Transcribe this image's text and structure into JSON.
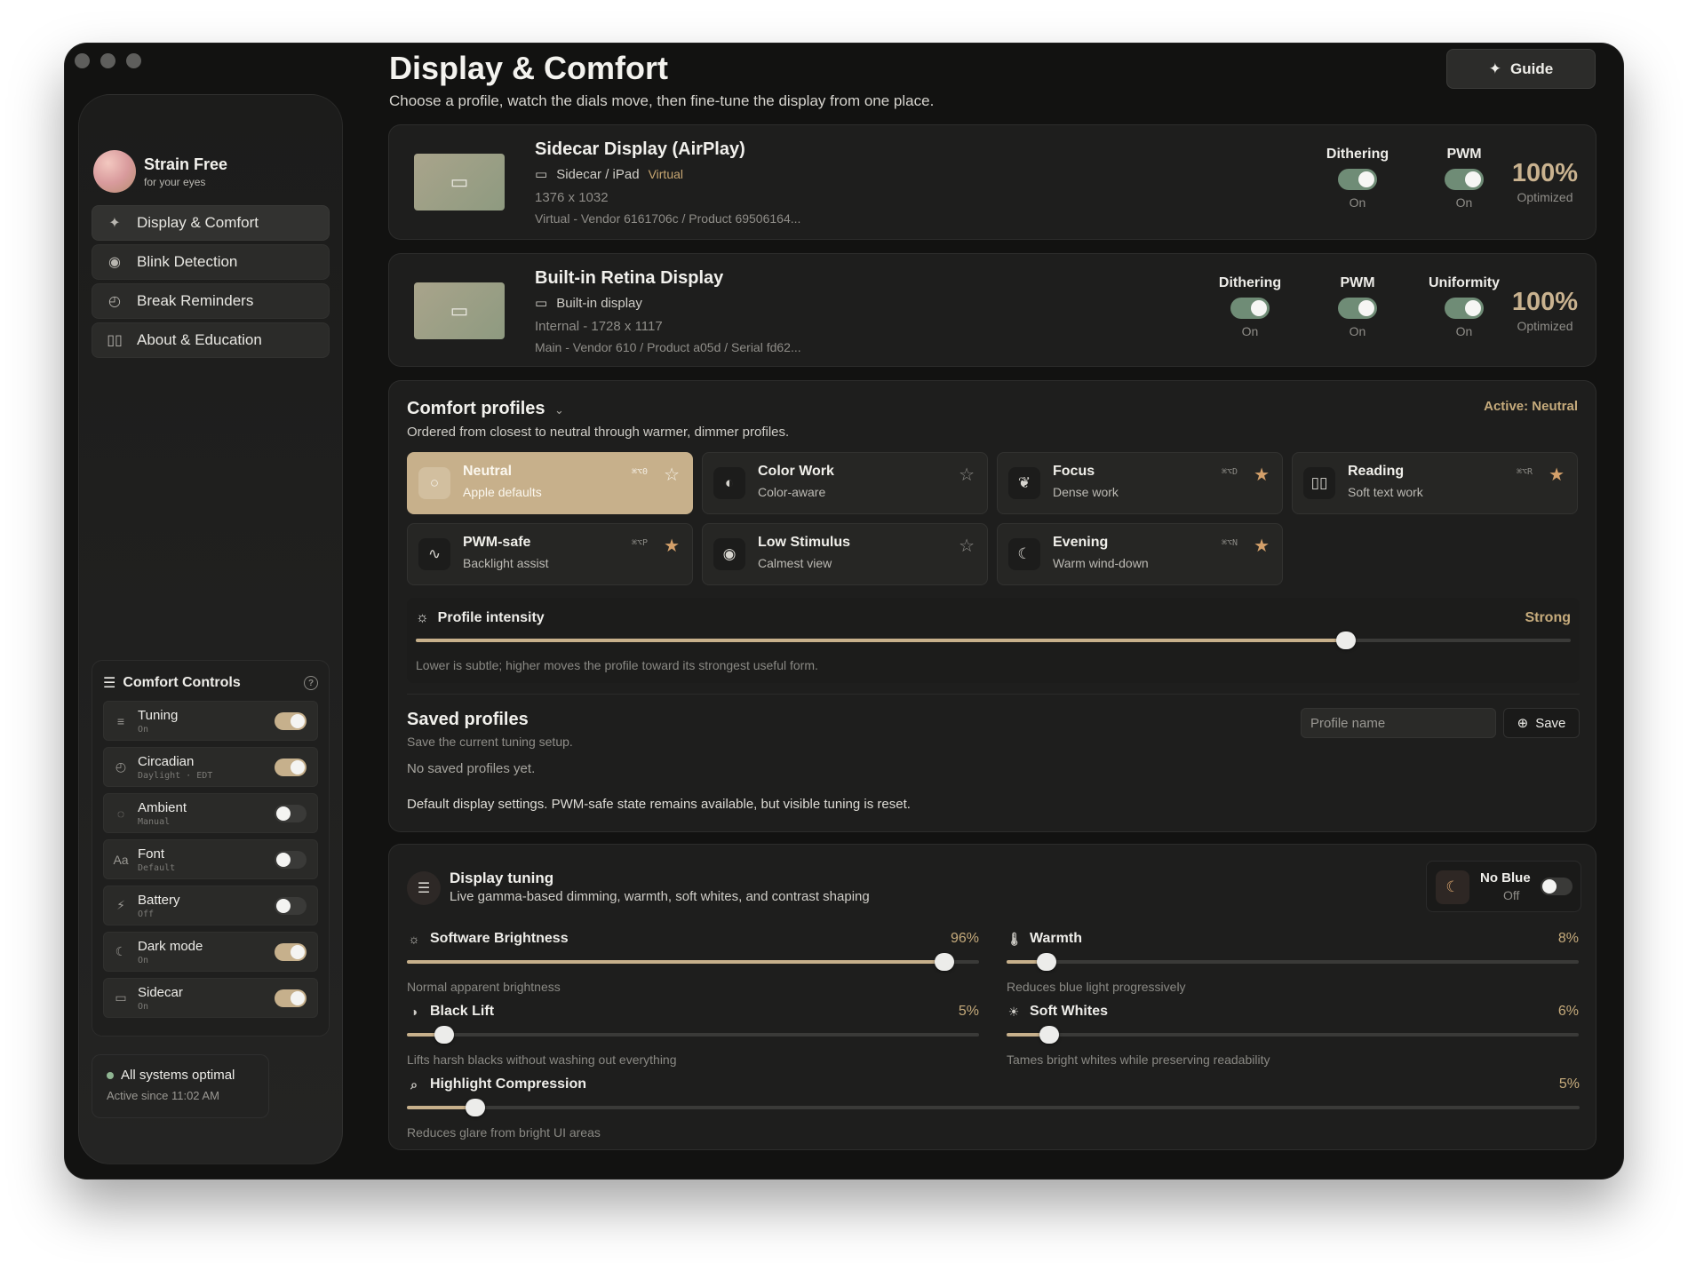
{
  "sidebar": {
    "brand": {
      "title": "Strain Free",
      "subtitle": "for your eyes"
    },
    "nav": [
      {
        "label": "Display & Comfort",
        "icon": "sparkle-icon",
        "glyph": "✦",
        "active": true
      },
      {
        "label": "Blink Detection",
        "icon": "eye-icon",
        "glyph": "◉",
        "active": false
      },
      {
        "label": "Break Reminders",
        "icon": "clock-icon",
        "glyph": "◴",
        "active": false
      },
      {
        "label": "About & Education",
        "icon": "book-icon",
        "glyph": "▯▯",
        "active": false
      }
    ],
    "controls": {
      "title": "Comfort Controls",
      "help": "?",
      "items": [
        {
          "name": "Tuning",
          "sub": "On",
          "on": true,
          "icon": "sliders-icon",
          "glyph": "≡"
        },
        {
          "name": "Circadian",
          "sub": "Daylight · EDT",
          "on": true,
          "icon": "clock-icon",
          "glyph": "◴"
        },
        {
          "name": "Ambient",
          "sub": "Manual",
          "on": false,
          "icon": "ambient-icon",
          "glyph": "◌"
        },
        {
          "name": "Font",
          "sub": "Default",
          "on": false,
          "icon": "font-icon",
          "glyph": "Aa"
        },
        {
          "name": "Battery",
          "sub": "Off",
          "on": false,
          "icon": "bolt-icon",
          "glyph": "⚡"
        },
        {
          "name": "Dark mode",
          "sub": "On",
          "on": true,
          "icon": "moon-icon",
          "glyph": "☾"
        },
        {
          "name": "Sidecar",
          "sub": "On",
          "on": true,
          "icon": "tablet-icon",
          "glyph": "▭"
        }
      ]
    },
    "status": {
      "title": "All systems optimal",
      "sub": "Active since 11:02 AM"
    }
  },
  "header": {
    "title": "Display & Comfort",
    "subtitle": "Choose a profile, watch the dials move, then fine-tune the display from one place.",
    "guide_label": "Guide"
  },
  "displays": [
    {
      "name": "Sidecar Display (AirPlay)",
      "kind": "Sidecar / iPad",
      "tag": "Virtual",
      "resolution": "1376 x 1032",
      "meta": "Virtual - Vendor 6161706c / Product 69506164...",
      "switches": [
        {
          "label": "Dithering",
          "state": "On"
        },
        {
          "label": "PWM",
          "state": "On"
        }
      ],
      "optimized_value": "100%",
      "optimized_label": "Optimized"
    },
    {
      "name": "Built-in Retina Display",
      "kind": "Built-in display",
      "tag": "",
      "resolution": "Internal - 1728 x 1117",
      "meta": "Main - Vendor 610 / Product a05d / Serial fd62...",
      "switches": [
        {
          "label": "Dithering",
          "state": "On"
        },
        {
          "label": "PWM",
          "state": "On"
        },
        {
          "label": "Uniformity",
          "state": "On"
        }
      ],
      "optimized_value": "100%",
      "optimized_label": "Optimized"
    }
  ],
  "profiles": {
    "title": "Comfort profiles",
    "subtitle": "Ordered from closest to neutral through warmer, dimmer profiles.",
    "active_label": "Active: Neutral",
    "items": [
      {
        "name": "Neutral",
        "sub": "Apple defaults",
        "shortcut": "⌘⌥0",
        "starred": false,
        "active": true,
        "icon": "circle-icon",
        "glyph": "○"
      },
      {
        "name": "Color Work",
        "sub": "Color-aware",
        "shortcut": "",
        "starred": false,
        "active": false,
        "icon": "palette-icon",
        "glyph": "◐"
      },
      {
        "name": "Focus",
        "sub": "Dense work",
        "shortcut": "⌘⌥D",
        "starred": true,
        "active": false,
        "icon": "brain-icon",
        "glyph": "❦"
      },
      {
        "name": "Reading",
        "sub": "Soft text work",
        "shortcut": "⌘⌥R",
        "starred": true,
        "active": false,
        "icon": "book-icon",
        "glyph": "▯▯"
      },
      {
        "name": "PWM-safe",
        "sub": "Backlight assist",
        "shortcut": "⌘⌥P",
        "starred": true,
        "active": false,
        "icon": "pulse-icon",
        "glyph": "∿"
      },
      {
        "name": "Low Stimulus",
        "sub": "Calmest view",
        "shortcut": "",
        "starred": false,
        "active": false,
        "icon": "eye-slash-icon",
        "glyph": "◉"
      },
      {
        "name": "Evening",
        "sub": "Warm wind-down",
        "shortcut": "⌘⌥N",
        "starred": true,
        "active": false,
        "icon": "moon-icon",
        "glyph": "☾"
      }
    ],
    "intensity": {
      "label": "Profile intensity",
      "level_label": "Strong",
      "value": 0.805,
      "hint": "Lower is subtle; higher moves the profile toward its strongest useful form."
    },
    "saved": {
      "title": "Saved profiles",
      "subtitle": "Save the current tuning setup.",
      "placeholder": "Profile name",
      "save_label": "Save",
      "empty": "No saved profiles yet.",
      "note": "Default display settings. PWM-safe state remains available, but visible tuning is reset."
    }
  },
  "tuning": {
    "title": "Display tuning",
    "subtitle": "Live gamma-based dimming, warmth, soft whites, and contrast shaping",
    "no_blue": {
      "label": "No Blue",
      "state": "Off"
    },
    "sliders": [
      {
        "label": "Software Brightness",
        "pct": "96%",
        "value": 0.94,
        "desc": "Normal apparent brightness",
        "icon": "sun-icon",
        "glyph": "☼"
      },
      {
        "label": "Warmth",
        "pct": "8%",
        "value": 0.07,
        "desc": "Reduces blue light progressively",
        "icon": "thermometer-icon",
        "glyph": "🌡"
      },
      {
        "label": "Black Lift",
        "pct": "5%",
        "value": 0.065,
        "desc": "Lifts harsh blacks without washing out everything",
        "icon": "contrast-icon",
        "glyph": "◑"
      },
      {
        "label": "Soft Whites",
        "pct": "6%",
        "value": 0.075,
        "desc": "Tames bright whites while preserving readability",
        "icon": "sunrise-icon",
        "glyph": "☀"
      },
      {
        "label": "Highlight Compression",
        "pct": "5%",
        "value": 0.058,
        "desc": "Reduces glare from bright UI areas",
        "icon": "zoom-icon",
        "glyph": "⌕"
      }
    ]
  },
  "colors": {
    "accent": "#c7b08b",
    "active_text": "#c6ab7c",
    "toggle_green": "#6f8c76",
    "status_ok": "#8fb592"
  }
}
